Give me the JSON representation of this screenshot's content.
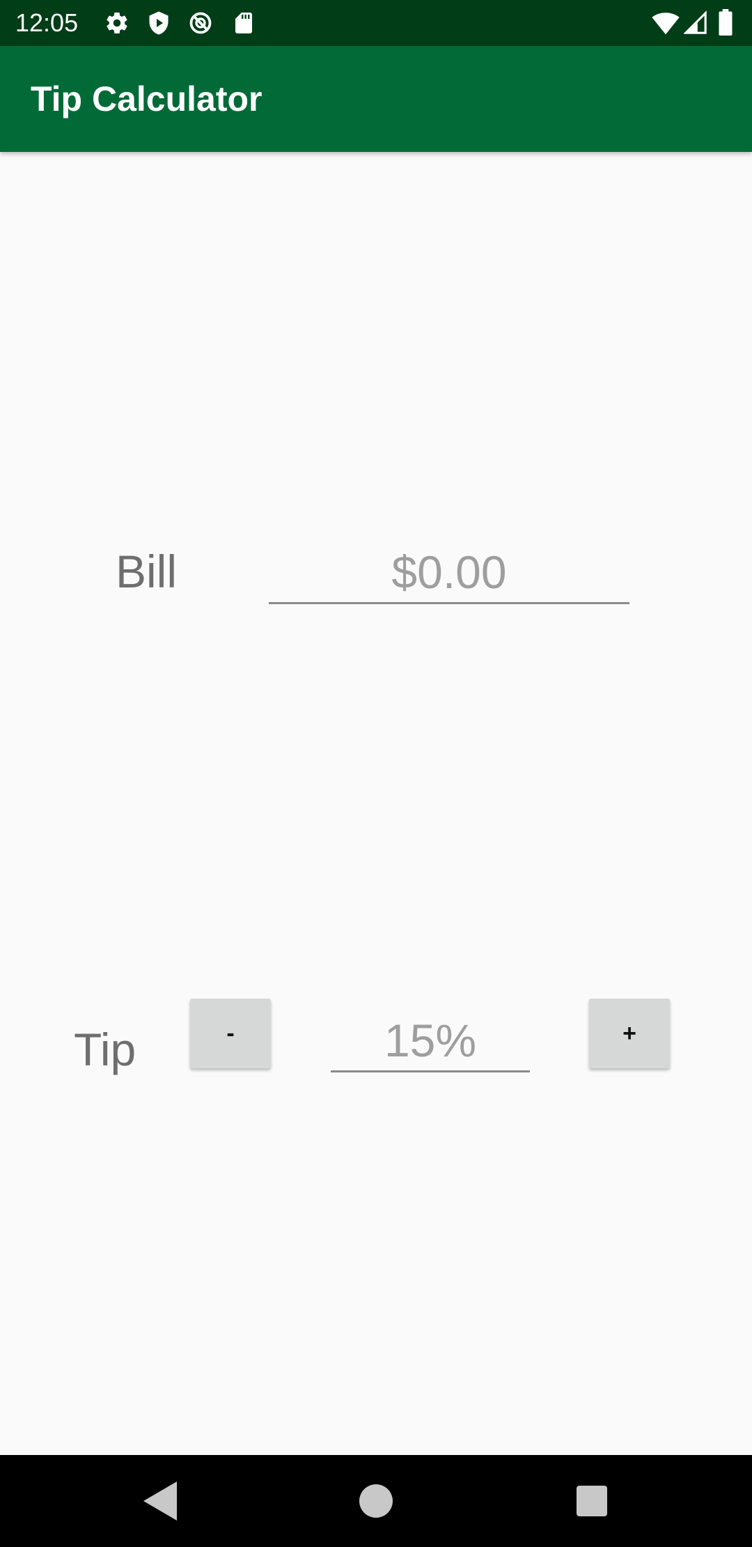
{
  "status_bar": {
    "time": "12:05",
    "icons": [
      "gear-icon",
      "shield-play-icon",
      "no-sync-icon",
      "sd-card-icon",
      "wifi-icon",
      "signal-icon",
      "battery-icon"
    ]
  },
  "app_bar": {
    "title": "Tip Calculator",
    "color": "#016a37",
    "status_color": "#013d17"
  },
  "form": {
    "bill_label": "Bill",
    "bill_placeholder": "$0.00",
    "tip_label": "Tip",
    "tip_placeholder": "15%",
    "decrement_label": "-",
    "increment_label": "+"
  },
  "nav_bar": {
    "icons": [
      "back-icon",
      "home-icon",
      "recents-icon"
    ]
  }
}
